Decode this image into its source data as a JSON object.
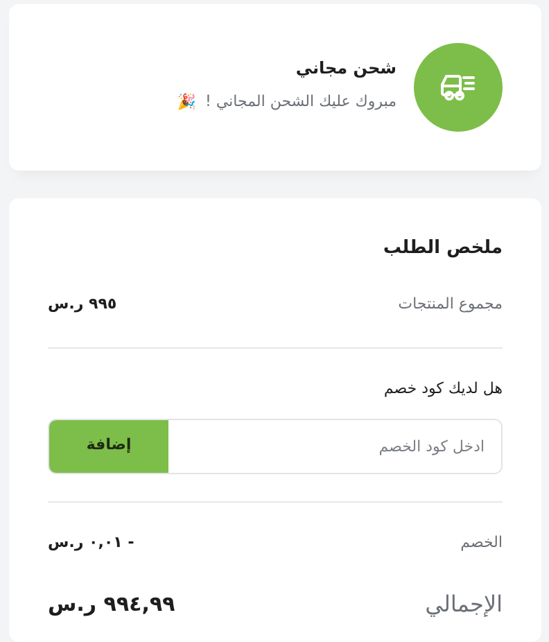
{
  "colors": {
    "accent": "#7dbe4a",
    "background": "#f3f4f6",
    "card": "#ffffff",
    "muted_text": "#6b6f76"
  },
  "shipping": {
    "icon": "delivery-truck-icon",
    "title": "شحن مجاني",
    "subtitle": "مبروك عليك الشحن المجاني !",
    "emoji": "🎉",
    "emoji_icon": "party-popper-icon"
  },
  "summary": {
    "title": "ملخص الطلب",
    "subtotal": {
      "label": "مجموع المنتجات",
      "value": "٩٩٥ ر.س"
    },
    "coupon": {
      "question": "هل لديك كود خصم",
      "placeholder": "ادخل كود الخصم",
      "value": "",
      "button_label": "إضافة"
    },
    "discount": {
      "label": "الخصم",
      "value": "- ٠,٠١ ر.س"
    },
    "total": {
      "label": "الإجمالي",
      "value": "٩٩٤,٩٩ ر.س"
    }
  }
}
